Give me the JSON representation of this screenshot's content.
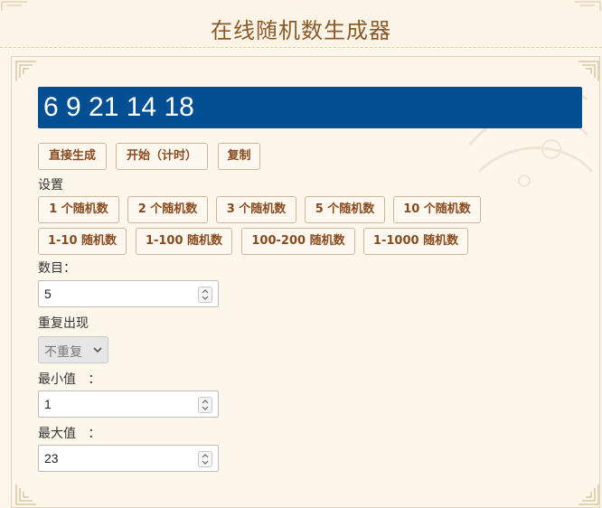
{
  "page": {
    "title": "在线随机数生成器"
  },
  "display": {
    "result": "6 9 21 14 18"
  },
  "actions": {
    "direct_label": "直接生成",
    "start_label": "开始（计时）",
    "copy_label": "复制"
  },
  "settings": {
    "label": "设置",
    "count_presets": [
      "1 个随机数",
      "2 个随机数",
      "3 个随机数",
      "5 个随机数",
      "10 个随机数"
    ],
    "range_presets": [
      "1-10 随机数",
      "1-100 随机数",
      "100-200 随机数",
      "1-1000 随机数"
    ]
  },
  "form": {
    "count_label": "数目：",
    "count_value": "5",
    "repeat_label": "重复出现",
    "repeat_value": "不重复",
    "min_label": "最小值   ：",
    "min_value": "1",
    "max_label": "最大值   ：",
    "max_value": "23"
  },
  "colors": {
    "accent_blue": "#034f94",
    "button_text": "#8a4a1f",
    "title": "#8a5a2b",
    "background": "#fdf6ea"
  }
}
